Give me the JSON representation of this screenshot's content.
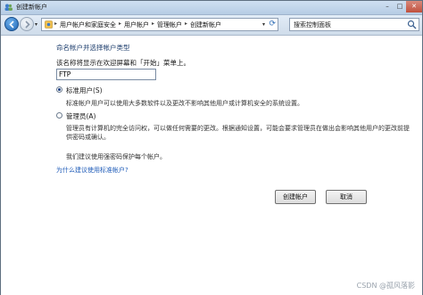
{
  "window": {
    "title": "创建新帐户",
    "controls": {
      "minimize": "–",
      "maximize": "□",
      "close": "✕"
    }
  },
  "nav": {
    "breadcrumbs": [
      "用户帐户和家庭安全",
      "用户帐户",
      "管理帐户",
      "创建新帐户"
    ],
    "search_placeholder": "搜索控制面板"
  },
  "form": {
    "heading": "命名帐户并选择帐户类型",
    "name_label": "该名称将显示在欢迎屏幕和「开始」菜单上。",
    "name_value": "FTP",
    "options": [
      {
        "label": "标准用户(S)",
        "description": "标准帐户用户可以使用大多数软件以及更改不影响其他用户或计算机安全的系统设置。",
        "selected": true
      },
      {
        "label": "管理员(A)",
        "description": "管理员有计算机的完全访问权，可以做任何需要的更改。根据通知设置，可能会要求管理员在做出会影响其他用户的更改前提供密码或确认。",
        "selected": false
      }
    ],
    "recommendation": "我们建议使用强密码保护每个帐户。",
    "help_link": "为什么建议使用标准帐户?"
  },
  "buttons": {
    "create": "创建帐户",
    "cancel": "取消"
  },
  "watermark": "CSDN @孤风落影",
  "colors": {
    "heading": "#1f3f6e",
    "link": "#1e5bb8",
    "titlebar": "#c3d6ea"
  }
}
